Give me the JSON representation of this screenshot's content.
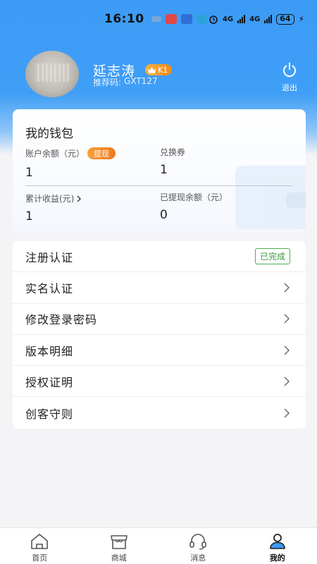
{
  "status_bar": {
    "time": "16:10",
    "network_1": "4G",
    "network_2": "4G",
    "battery": "64"
  },
  "profile": {
    "name": "延志涛",
    "level": "K1",
    "referral_label": "推荐码:",
    "referral_code": "GXT127",
    "logout_label": "退出"
  },
  "wallet": {
    "title": "我的钱包",
    "balance_label": "账户余额（元）",
    "balance_value": "1",
    "withdraw_label": "提现",
    "voucher_label": "兑换券",
    "voucher_value": "1",
    "earnings_label": "累计收益(元)",
    "earnings_value": "1",
    "withdrawn_label": "已提现余额（元）",
    "withdrawn_value": "0"
  },
  "menu": {
    "items": [
      {
        "label": "注册认证",
        "status": "已完成"
      },
      {
        "label": "实名认证"
      },
      {
        "label": "修改登录密码"
      },
      {
        "label": "版本明细"
      },
      {
        "label": "授权证明"
      },
      {
        "label": "创客守则"
      }
    ]
  },
  "tabbar": {
    "tabs": [
      {
        "label": "首页",
        "icon": "home-icon"
      },
      {
        "label": "商城",
        "icon": "shop-icon"
      },
      {
        "label": "消息",
        "icon": "headset-icon"
      },
      {
        "label": "我的",
        "icon": "user-icon",
        "active": true
      }
    ]
  },
  "colors": {
    "brand_blue": "#3c9bf5",
    "withdraw_orange": "#f0781c",
    "done_green": "#4caf50"
  }
}
